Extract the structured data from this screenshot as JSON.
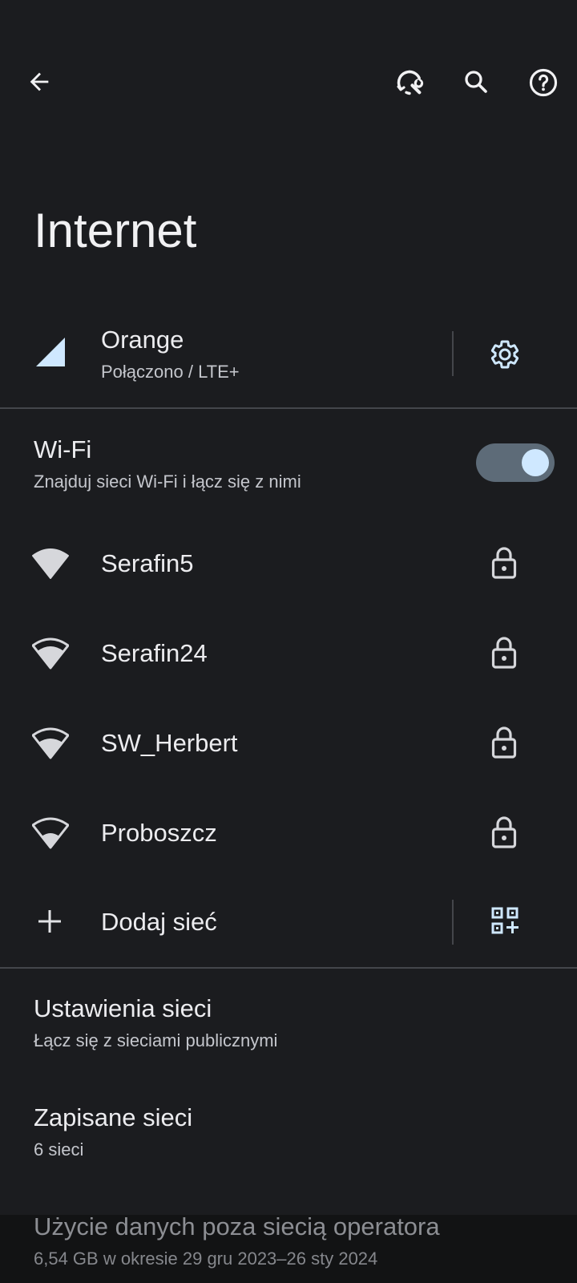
{
  "header": {
    "back_icon": "arrow-back-icon",
    "actions": [
      "network-reset-icon",
      "search-icon",
      "help-icon"
    ]
  },
  "page": {
    "title": "Internet"
  },
  "mobile": {
    "carrier": "Orange",
    "status": "Połączono / LTE+",
    "signal_icon": "cell-signal-icon",
    "settings_icon": "gear-icon"
  },
  "wifi": {
    "title": "Wi-Fi",
    "subtitle": "Znajduj sieci Wi-Fi i łącz się z nimi",
    "enabled": true,
    "networks": [
      {
        "name": "Serafin5",
        "signal": "full",
        "locked": true
      },
      {
        "name": "Serafin24",
        "signal": "strong",
        "locked": true
      },
      {
        "name": "SW_Herbert",
        "signal": "strong",
        "locked": true
      },
      {
        "name": "Proboszcz",
        "signal": "medium",
        "locked": true
      }
    ],
    "add_network_label": "Dodaj sieć",
    "add_icon": "plus-icon",
    "qr_icon": "qr-scan-icon"
  },
  "settings": [
    {
      "title": "Ustawienia sieci",
      "subtitle": "Łącz się z sieciami publicznymi"
    },
    {
      "title": "Zapisane sieci",
      "subtitle": "6 sieci"
    },
    {
      "title": "Użycie danych poza siecią operatora",
      "subtitle": "6,54 GB w okresie 29 gru 2023–26 sty 2024"
    }
  ],
  "colors": {
    "background": "#1b1c1f",
    "accent": "#cfe8ff",
    "divider": "#44464b",
    "toggle_track": "#5d6b78"
  }
}
